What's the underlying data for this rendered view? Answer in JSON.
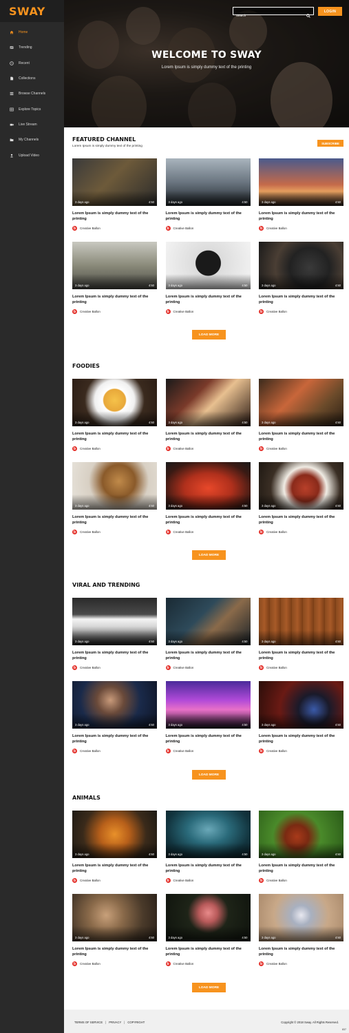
{
  "app": {
    "logo": "SWAY"
  },
  "sidebar": {
    "items": [
      {
        "label": "Home",
        "icon": "home-icon"
      },
      {
        "label": "Trending",
        "icon": "trending-icon"
      },
      {
        "label": "Recent",
        "icon": "clock-icon"
      },
      {
        "label": "Collections",
        "icon": "document-icon"
      },
      {
        "label": "Browse Channels",
        "icon": "list-icon"
      },
      {
        "label": "Explore Topics",
        "icon": "grid-icon"
      },
      {
        "label": "Live Stream",
        "icon": "video-camera-icon"
      },
      {
        "label": "My Channels",
        "icon": "folder-icon"
      },
      {
        "label": "Upload Video",
        "icon": "user-upload-icon"
      }
    ],
    "active": "Home"
  },
  "header": {
    "search_placeholder": "Search",
    "login_label": "LOGIN",
    "hero_title": "WELCOME TO SWAY",
    "hero_subtitle": "Lorem Ipsum is simply dummy text of the printing"
  },
  "sections": [
    {
      "title": "FEATURED CHANNEL",
      "subtitle": "Lorem Ipsum is simply dummy text of the printing",
      "subscribe_label": "SUBSCRIBE",
      "load_more": "LOAD MORE",
      "cards": [
        {
          "ago": "3 days ago",
          "duration": "4:50",
          "title": "Lorem Ipsum is simply dummy text of the printing",
          "channel": "Creative Ballon"
        },
        {
          "ago": "3 days ago",
          "duration": "4:50",
          "title": "Lorem Ipsum is simply dummy text of the printing",
          "channel": "Creative Ballon"
        },
        {
          "ago": "3 days ago",
          "duration": "4:50",
          "title": "Lorem Ipsum is simply dummy text of the printing",
          "channel": "Creative Ballon"
        },
        {
          "ago": "3 days ago",
          "duration": "4:50",
          "title": "Lorem Ipsum is simply dummy text of the printing",
          "channel": "Creative Ballon"
        },
        {
          "ago": "3 days ago",
          "duration": "4:50",
          "title": "Lorem Ipsum is simply dummy text of the printing",
          "channel": "Creative Ballon"
        },
        {
          "ago": "3 days ago",
          "duration": "4:50",
          "title": "Lorem Ipsum is simply dummy text of the printing",
          "channel": "Creative Ballon"
        }
      ]
    },
    {
      "title": "FOODIES",
      "load_more": "LOAD MORE",
      "cards": [
        {
          "ago": "3 days ago",
          "duration": "4:50",
          "title": "Lorem Ipsum is simply dummy text of the printing",
          "channel": "Creative Ballon"
        },
        {
          "ago": "3 days ago",
          "duration": "4:50",
          "title": "Lorem Ipsum is simply dummy text of the printing",
          "channel": "Creative Ballon"
        },
        {
          "ago": "3 days ago",
          "duration": "4:50",
          "title": "Lorem Ipsum is simply dummy text of the printing",
          "channel": "Creative Ballon"
        },
        {
          "ago": "3 days ago",
          "duration": "4:50",
          "title": "Lorem Ipsum is simply dummy text of the printing",
          "channel": "Creative Ballon"
        },
        {
          "ago": "3 days ago",
          "duration": "4:50",
          "title": "Lorem Ipsum is simply dummy text of the printing",
          "channel": "Creative Ballon"
        },
        {
          "ago": "3 days ago",
          "duration": "4:50",
          "title": "Lorem Ipsum is simply dummy text of the printing",
          "channel": "Creative Ballon"
        }
      ]
    },
    {
      "title": "VIRAL AND TRENDING",
      "load_more": "LOAD MORE",
      "cards": [
        {
          "ago": "3 days ago",
          "duration": "4:50",
          "title": "Lorem Ipsum is simply dummy text of the printing",
          "channel": "Creative Ballon"
        },
        {
          "ago": "3 days ago",
          "duration": "4:50",
          "title": "Lorem Ipsum is simply dummy text of the printing",
          "channel": "Creative Ballon"
        },
        {
          "ago": "3 days ago",
          "duration": "4:50",
          "title": "Lorem Ipsum is simply dummy text of the printing",
          "channel": "Creative Ballon"
        },
        {
          "ago": "3 days ago",
          "duration": "4:50",
          "title": "Lorem Ipsum is simply dummy text of the printing",
          "channel": "Creative Ballon"
        },
        {
          "ago": "3 days ago",
          "duration": "4:50",
          "title": "Lorem Ipsum is simply dummy text of the printing",
          "channel": "Creative Ballon"
        },
        {
          "ago": "3 days ago",
          "duration": "4:50",
          "title": "Lorem Ipsum is simply dummy text of the printing",
          "channel": "Creative Ballon"
        }
      ]
    },
    {
      "title": "ANIMALS",
      "load_more": "LOAD MORE",
      "cards": [
        {
          "ago": "3 days ago",
          "duration": "4:50",
          "title": "Lorem Ipsum is simply dummy text of the printing",
          "channel": "Creative Ballon"
        },
        {
          "ago": "3 days ago",
          "duration": "4:50",
          "title": "Lorem Ipsum is simply dummy text of the printing",
          "channel": "Creative Ballon"
        },
        {
          "ago": "3 days ago",
          "duration": "4:50",
          "title": "Lorem Ipsum is simply dummy text of the printing",
          "channel": "Creative Ballon"
        },
        {
          "ago": "3 days ago",
          "duration": "4:50",
          "title": "Lorem Ipsum is simply dummy text of the printing",
          "channel": "Creative Ballon"
        },
        {
          "ago": "3 days ago",
          "duration": "4:50",
          "title": "Lorem Ipsum is simply dummy text of the printing",
          "channel": "Creative Ballon"
        },
        {
          "ago": "3 days ago",
          "duration": "4:50",
          "title": "Lorem Ipsum is simply dummy text of the printing",
          "channel": "Creative Ballon"
        }
      ]
    }
  ],
  "footer": {
    "links": [
      "TERMS OF SERVICE",
      "PRIVACY",
      "COPYRIGHT"
    ],
    "copyright": "Copyright © 2018 Sway. All Rights Reserved.",
    "version": "837"
  },
  "colors": {
    "accent": "#f7931e",
    "sidebar": "#2a2a2a",
    "badge": "#e4312b"
  }
}
